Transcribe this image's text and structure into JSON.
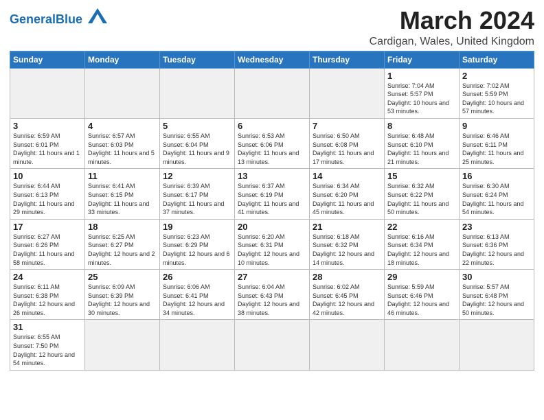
{
  "header": {
    "logo_general": "General",
    "logo_blue": "Blue",
    "month": "March 2024",
    "location": "Cardigan, Wales, United Kingdom"
  },
  "days_of_week": [
    "Sunday",
    "Monday",
    "Tuesday",
    "Wednesday",
    "Thursday",
    "Friday",
    "Saturday"
  ],
  "weeks": [
    [
      {
        "day": "",
        "info": ""
      },
      {
        "day": "",
        "info": ""
      },
      {
        "day": "",
        "info": ""
      },
      {
        "day": "",
        "info": ""
      },
      {
        "day": "",
        "info": ""
      },
      {
        "day": "1",
        "info": "Sunrise: 7:04 AM\nSunset: 5:57 PM\nDaylight: 10 hours\nand 53 minutes."
      },
      {
        "day": "2",
        "info": "Sunrise: 7:02 AM\nSunset: 5:59 PM\nDaylight: 10 hours\nand 57 minutes."
      }
    ],
    [
      {
        "day": "3",
        "info": "Sunrise: 6:59 AM\nSunset: 6:01 PM\nDaylight: 11 hours\nand 1 minute."
      },
      {
        "day": "4",
        "info": "Sunrise: 6:57 AM\nSunset: 6:03 PM\nDaylight: 11 hours\nand 5 minutes."
      },
      {
        "day": "5",
        "info": "Sunrise: 6:55 AM\nSunset: 6:04 PM\nDaylight: 11 hours\nand 9 minutes."
      },
      {
        "day": "6",
        "info": "Sunrise: 6:53 AM\nSunset: 6:06 PM\nDaylight: 11 hours\nand 13 minutes."
      },
      {
        "day": "7",
        "info": "Sunrise: 6:50 AM\nSunset: 6:08 PM\nDaylight: 11 hours\nand 17 minutes."
      },
      {
        "day": "8",
        "info": "Sunrise: 6:48 AM\nSunset: 6:10 PM\nDaylight: 11 hours\nand 21 minutes."
      },
      {
        "day": "9",
        "info": "Sunrise: 6:46 AM\nSunset: 6:11 PM\nDaylight: 11 hours\nand 25 minutes."
      }
    ],
    [
      {
        "day": "10",
        "info": "Sunrise: 6:44 AM\nSunset: 6:13 PM\nDaylight: 11 hours\nand 29 minutes."
      },
      {
        "day": "11",
        "info": "Sunrise: 6:41 AM\nSunset: 6:15 PM\nDaylight: 11 hours\nand 33 minutes."
      },
      {
        "day": "12",
        "info": "Sunrise: 6:39 AM\nSunset: 6:17 PM\nDaylight: 11 hours\nand 37 minutes."
      },
      {
        "day": "13",
        "info": "Sunrise: 6:37 AM\nSunset: 6:19 PM\nDaylight: 11 hours\nand 41 minutes."
      },
      {
        "day": "14",
        "info": "Sunrise: 6:34 AM\nSunset: 6:20 PM\nDaylight: 11 hours\nand 45 minutes."
      },
      {
        "day": "15",
        "info": "Sunrise: 6:32 AM\nSunset: 6:22 PM\nDaylight: 11 hours\nand 50 minutes."
      },
      {
        "day": "16",
        "info": "Sunrise: 6:30 AM\nSunset: 6:24 PM\nDaylight: 11 hours\nand 54 minutes."
      }
    ],
    [
      {
        "day": "17",
        "info": "Sunrise: 6:27 AM\nSunset: 6:26 PM\nDaylight: 11 hours\nand 58 minutes."
      },
      {
        "day": "18",
        "info": "Sunrise: 6:25 AM\nSunset: 6:27 PM\nDaylight: 12 hours\nand 2 minutes."
      },
      {
        "day": "19",
        "info": "Sunrise: 6:23 AM\nSunset: 6:29 PM\nDaylight: 12 hours\nand 6 minutes."
      },
      {
        "day": "20",
        "info": "Sunrise: 6:20 AM\nSunset: 6:31 PM\nDaylight: 12 hours\nand 10 minutes."
      },
      {
        "day": "21",
        "info": "Sunrise: 6:18 AM\nSunset: 6:32 PM\nDaylight: 12 hours\nand 14 minutes."
      },
      {
        "day": "22",
        "info": "Sunrise: 6:16 AM\nSunset: 6:34 PM\nDaylight: 12 hours\nand 18 minutes."
      },
      {
        "day": "23",
        "info": "Sunrise: 6:13 AM\nSunset: 6:36 PM\nDaylight: 12 hours\nand 22 minutes."
      }
    ],
    [
      {
        "day": "24",
        "info": "Sunrise: 6:11 AM\nSunset: 6:38 PM\nDaylight: 12 hours\nand 26 minutes."
      },
      {
        "day": "25",
        "info": "Sunrise: 6:09 AM\nSunset: 6:39 PM\nDaylight: 12 hours\nand 30 minutes."
      },
      {
        "day": "26",
        "info": "Sunrise: 6:06 AM\nSunset: 6:41 PM\nDaylight: 12 hours\nand 34 minutes."
      },
      {
        "day": "27",
        "info": "Sunrise: 6:04 AM\nSunset: 6:43 PM\nDaylight: 12 hours\nand 38 minutes."
      },
      {
        "day": "28",
        "info": "Sunrise: 6:02 AM\nSunset: 6:45 PM\nDaylight: 12 hours\nand 42 minutes."
      },
      {
        "day": "29",
        "info": "Sunrise: 5:59 AM\nSunset: 6:46 PM\nDaylight: 12 hours\nand 46 minutes."
      },
      {
        "day": "30",
        "info": "Sunrise: 5:57 AM\nSunset: 6:48 PM\nDaylight: 12 hours\nand 50 minutes."
      }
    ],
    [
      {
        "day": "31",
        "info": "Sunrise: 6:55 AM\nSunset: 7:50 PM\nDaylight: 12 hours\nand 54 minutes."
      },
      {
        "day": "",
        "info": ""
      },
      {
        "day": "",
        "info": ""
      },
      {
        "day": "",
        "info": ""
      },
      {
        "day": "",
        "info": ""
      },
      {
        "day": "",
        "info": ""
      },
      {
        "day": "",
        "info": ""
      }
    ]
  ]
}
